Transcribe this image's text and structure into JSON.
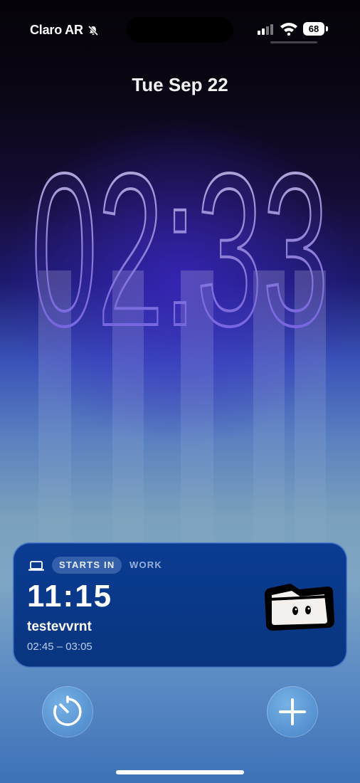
{
  "status_bar": {
    "carrier": "Claro AR",
    "silent_icon": "bell-slash-icon",
    "signal_icon": "signal-icon",
    "wifi_icon": "wifi-icon",
    "battery": "68"
  },
  "date": "Tue Sep 22",
  "time": "02:33",
  "widget": {
    "device_icon": "laptop-icon",
    "badge": "STARTS IN",
    "category": "WORK",
    "countdown": "11:15",
    "title": "testevvrnt",
    "range": "02:45 – 03:05",
    "mascot_icon": "folder-mascot-icon"
  },
  "controls": {
    "left": "timer-icon",
    "right": "plus-icon"
  },
  "colors": {
    "widget_bg": "#0b3c92",
    "clock_glow": "#7a66ff"
  }
}
